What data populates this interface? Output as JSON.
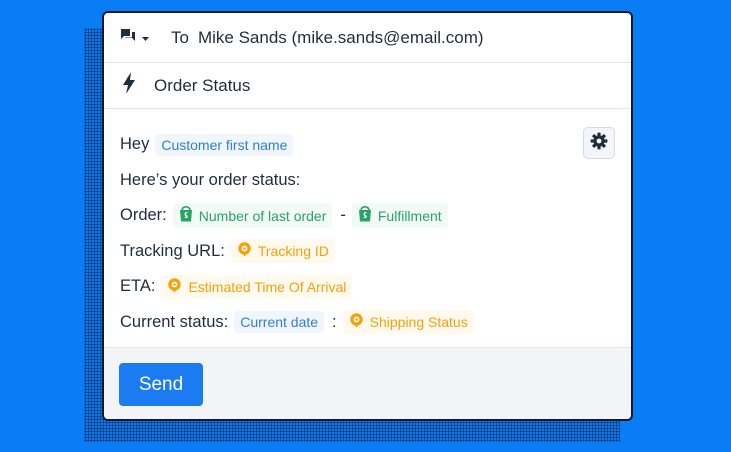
{
  "composer": {
    "to_label": "To",
    "recipient": "Mike Sands (mike.sands@email.com)",
    "template_title": "Order Status",
    "send_label": "Send"
  },
  "message": {
    "greeting": "Hey",
    "customer_first_name": "Customer first name",
    "intro": "Here’s your order status:",
    "order_label": "Order:",
    "order_var": "Number of last order",
    "order_sep": "-",
    "fulfillment_var": "Fulfillment",
    "tracking_label": "Tracking URL:",
    "tracking_var": "Tracking ID",
    "eta_label": "ETA:",
    "eta_var": "Estimated Time Of Arrival",
    "status_label": "Current status:",
    "status_date_var": "Current date",
    "status_sep": ":",
    "status_var": "Shipping Status"
  },
  "icons": {
    "channel": "chat-bubble-icon",
    "template": "lightning-icon",
    "settings": "gear-icon",
    "shopify": "shopify-bag-icon",
    "tracking": "location-pin-icon"
  },
  "colors": {
    "background": "#0a7cf5",
    "accent": "#1a7cf0",
    "variable_blue": "#2f7fd6",
    "shopify_green": "#29a36a",
    "tracking_orange": "#f2a20c"
  }
}
